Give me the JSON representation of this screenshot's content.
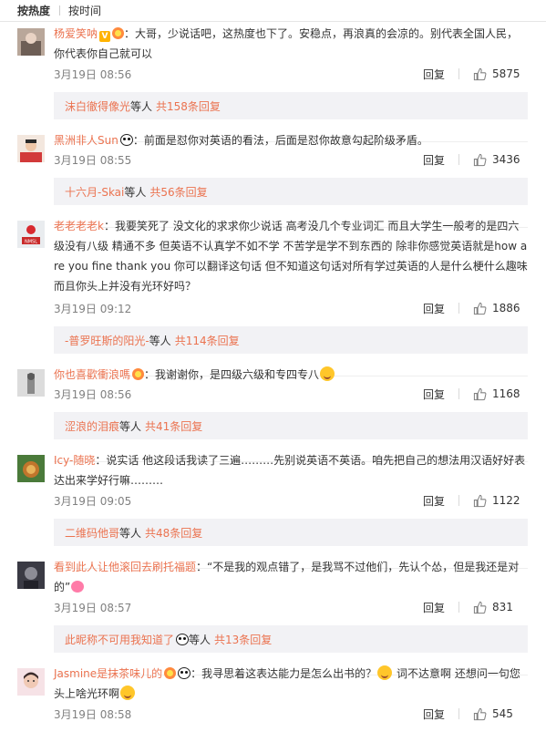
{
  "sort": {
    "hot": "按热度",
    "time": "按时间"
  },
  "comments": [
    {
      "user": "杨爱笑呐",
      "text": "：大哥，少说话吧，这热度也下了。安稳点，再浪真的会凉的。别代表全国人民，你代表你自己就可以",
      "time": "3月19日 08:56",
      "reply": "回复",
      "likes": "5875",
      "sub_user": "沫白徹得像光",
      "sub_mid": " 等人 ",
      "sub_count": "共158条回复"
    },
    {
      "user": "黑洲非人Sun",
      "text": "：前面是怼你对英语的看法，后面是怼你故意勾起阶级矛盾。",
      "time": "3月19日 08:55",
      "reply": "回复",
      "likes": "3436",
      "sub_user": "十六月-Skai",
      "sub_mid": " 等人 ",
      "sub_count": "共56条回复"
    },
    {
      "user": "老老老老k",
      "text": "：我要笑死了 没文化的求求你少说话 高考没几个专业词汇 而且大学生一般考的是四六级没有八级 精通不多 但英语不认真学不如不学 不苦学是学不到东西的 除非你感觉英语就是how are you fine thank you 你可以翻译这句话 但不知道这句话对所有学过英语的人是什么梗什么趣味 而且你头上并没有光环好吗？",
      "time": "3月19日 09:12",
      "reply": "回复",
      "likes": "1886",
      "sub_user": "-普罗旺斯的阳光-",
      "sub_mid": " 等人 ",
      "sub_count": "共114条回复"
    },
    {
      "user": "你也喜歡衝浪嗎",
      "text": "：我谢谢你，是四级六级和专四专八",
      "time": "3月19日 08:56",
      "reply": "回复",
      "likes": "1168",
      "sub_user": "涩浪的泪痕",
      "sub_mid": " 等人 ",
      "sub_count": "共41条回复"
    },
    {
      "user": "Icy-随晓",
      "text": "：说实话 他这段话我读了三遍………先别说英语不英语。咱先把自己的想法用汉语好好表达出来学好行嘛………",
      "time": "3月19日 09:05",
      "reply": "回复",
      "likes": "1122",
      "sub_user": "二维码他哥",
      "sub_mid": " 等人 ",
      "sub_count": "共48条回复"
    },
    {
      "user": "看到此人让他滚回去刷托福题",
      "text": "：“不是我的观点错了，是我骂不过他们，先认个怂，但是我还是对的”",
      "time": "3月19日 08:57",
      "reply": "回复",
      "likes": "831",
      "sub_user": "此昵称不可用我知道了",
      "sub_mid": " 等人 ",
      "sub_count": "共13条回复"
    },
    {
      "user": "Jasmine是抹茶味儿的",
      "text_a": "：我寻思着这表达能力是怎么出书的？",
      "text_b": " 词不达意啊 还想问一句您头上啥光环啊",
      "time": "3月19日 08:58",
      "reply": "回复",
      "likes": "545"
    }
  ],
  "colors": {
    "username": "#eb7350",
    "sub_bar_bg": "#f2f2f5",
    "meta": "#808080"
  }
}
